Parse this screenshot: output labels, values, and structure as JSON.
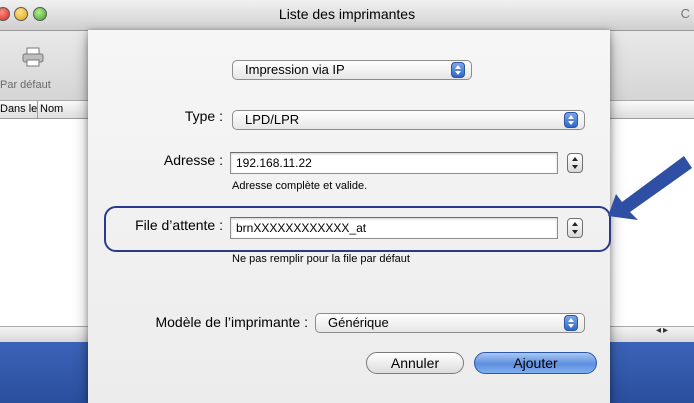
{
  "window": {
    "title": "Liste des imprimantes",
    "right_glyph": "C"
  },
  "toolbar": {
    "default_label": "Par défaut"
  },
  "list": {
    "col_in": "Dans le",
    "col_name": "Nom"
  },
  "sheet": {
    "protocol_popup": "Impression via IP",
    "type_label": "Type :",
    "type_value": "LPD/LPR",
    "address_label": "Adresse :",
    "address_value": "192.168.11.22",
    "address_hint": "Adresse complète et valide.",
    "queue_label": "File d’attente :",
    "queue_value": "brnXXXXXXXXXXXX_at",
    "queue_hint": "Ne pas remplir pour la file par défaut",
    "model_label": "Modèle de l’imprimante :",
    "model_value": "Générique",
    "cancel_label": "Annuler",
    "add_label": "Ajouter"
  },
  "colors": {
    "accent": "#2f67c9",
    "arrow": "#2e4fa3",
    "highlight_border": "#2b3a8a",
    "bottom_band": "#2f56a6"
  }
}
